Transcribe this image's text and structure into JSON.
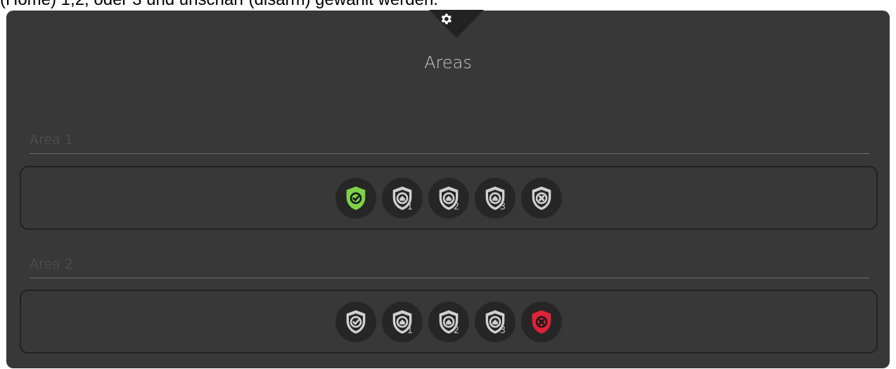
{
  "top_text": "(Home) 1,2, oder 3 und unscharf (disarm) gewählt werden.",
  "panel": {
    "title": "Areas",
    "settings_icon": "gear-icon"
  },
  "areas": [
    {
      "label": "Area 1",
      "active_mode": "armed",
      "modes": [
        {
          "id": "armed",
          "icon": "shield-check-icon",
          "number": ""
        },
        {
          "id": "home1",
          "icon": "shield-home-icon",
          "number": "1"
        },
        {
          "id": "home2",
          "icon": "shield-home-icon",
          "number": "2"
        },
        {
          "id": "home3",
          "icon": "shield-home-icon",
          "number": "3"
        },
        {
          "id": "disarm",
          "icon": "shield-x-icon",
          "number": ""
        }
      ]
    },
    {
      "label": "Area 2",
      "active_mode": "disarm",
      "modes": [
        {
          "id": "armed",
          "icon": "shield-check-icon",
          "number": ""
        },
        {
          "id": "home1",
          "icon": "shield-home-icon",
          "number": "1"
        },
        {
          "id": "home2",
          "icon": "shield-home-icon",
          "number": "2"
        },
        {
          "id": "home3",
          "icon": "shield-home-icon",
          "number": "3"
        },
        {
          "id": "disarm",
          "icon": "shield-x-icon",
          "number": ""
        }
      ]
    }
  ],
  "colors": {
    "armed_active": "#7ed348",
    "disarm_active": "#e2213a",
    "inactive": "#d0d0d0"
  }
}
